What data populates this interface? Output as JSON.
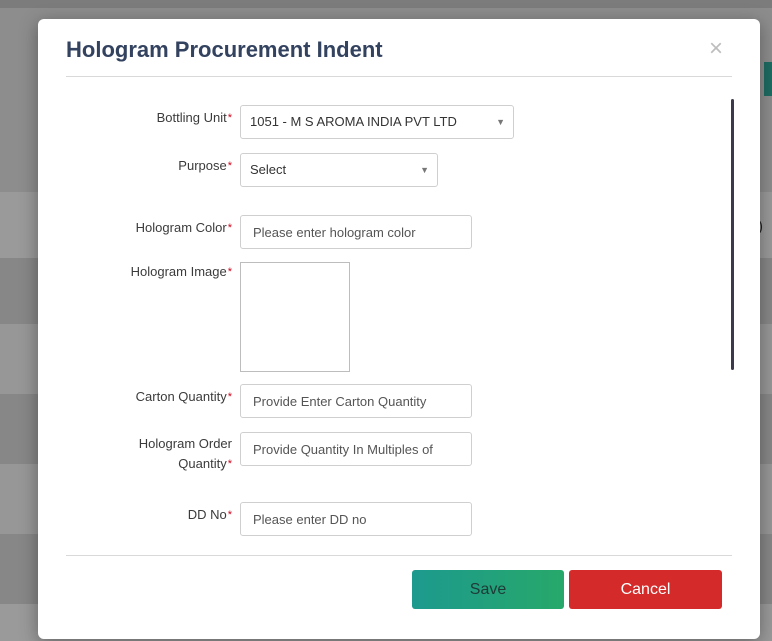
{
  "modal": {
    "title": "Hologram Procurement Indent",
    "close_glyph": "×"
  },
  "form": {
    "bottling_unit": {
      "label": "Bottling Unit",
      "required_mark": "*",
      "value": "1051 - M S AROMA INDIA PVT LTD"
    },
    "purpose": {
      "label": "Purpose",
      "required_mark": "*",
      "value": "Select"
    },
    "hologram_color": {
      "label": "Hologram Color",
      "required_mark": "*",
      "placeholder": "Please enter hologram color"
    },
    "hologram_image": {
      "label": "Hologram Image",
      "required_mark": "*"
    },
    "carton_quantity": {
      "label": "Carton Quantity",
      "required_mark": "*",
      "placeholder": "Provide Enter Carton Quantity"
    },
    "hologram_order_quantity": {
      "label_line1": "Hologram Order",
      "label_line2": "Quantity",
      "required_mark": "*",
      "placeholder": "Provide Quantity In Multiples of"
    },
    "dd_no": {
      "label": "DD No",
      "required_mark": "*",
      "placeholder": "Please enter DD no"
    }
  },
  "footer": {
    "save_label": "Save",
    "cancel_label": "Cancel"
  },
  "background": {
    "paren_fragment": ")"
  },
  "icons": {
    "dropdown": "caret-down-icon",
    "close": "close-icon"
  },
  "colors": {
    "title": "#33425f",
    "required": "#d0021b",
    "save_button": "#1d9a8e",
    "cancel_button": "#d42a2a"
  }
}
